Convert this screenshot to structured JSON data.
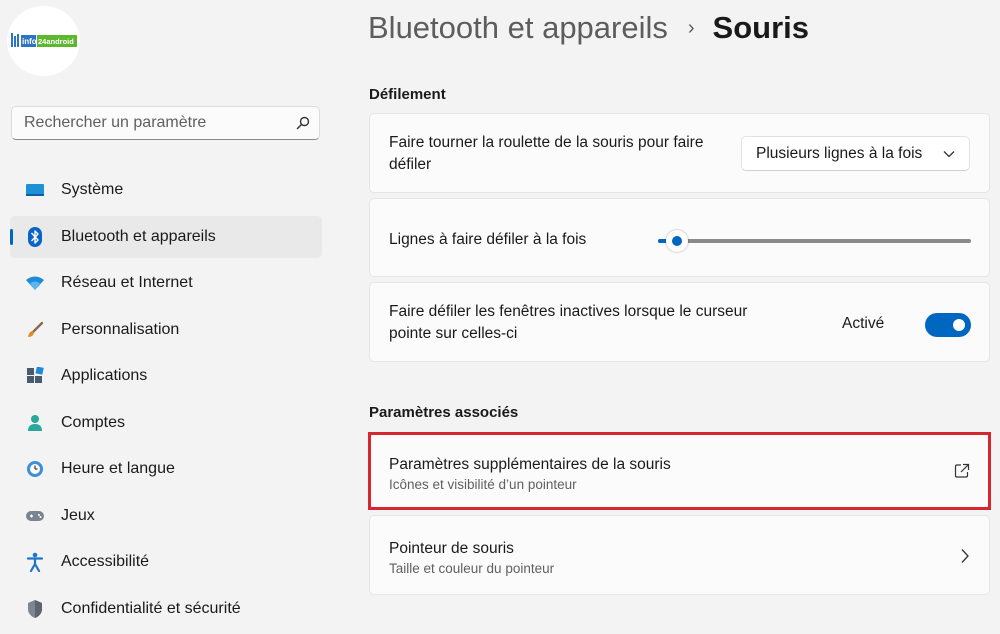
{
  "sidebar": {
    "logo_text_1": "info",
    "logo_text_2": "24android",
    "search": {
      "placeholder": "Rechercher un paramètre"
    },
    "items": [
      {
        "label": "Système",
        "icon": "monitor-icon",
        "active": false
      },
      {
        "label": "Bluetooth et appareils",
        "icon": "bluetooth-icon",
        "active": true
      },
      {
        "label": "Réseau et Internet",
        "icon": "wifi-icon",
        "active": false
      },
      {
        "label": "Personnalisation",
        "icon": "brush-icon",
        "active": false
      },
      {
        "label": "Applications",
        "icon": "apps-icon",
        "active": false
      },
      {
        "label": "Comptes",
        "icon": "person-icon",
        "active": false
      },
      {
        "label": "Heure et langue",
        "icon": "clock-globe-icon",
        "active": false
      },
      {
        "label": "Jeux",
        "icon": "gamepad-icon",
        "active": false
      },
      {
        "label": "Accessibilité",
        "icon": "accessibility-icon",
        "active": false
      },
      {
        "label": "Confidentialité et sécurité",
        "icon": "shield-icon",
        "active": false
      }
    ]
  },
  "header": {
    "parent": "Bluetooth et appareils",
    "separator": "›",
    "current": "Souris"
  },
  "scrolling": {
    "title": "Défilement",
    "wheel": {
      "label": "Faire tourner la roulette de la souris pour faire défiler",
      "selected": "Plusieurs lignes à la fois"
    },
    "lines": {
      "label": "Lignes à faire défiler à la fois",
      "value_fraction": 0.06
    },
    "inactive": {
      "label": "Faire défiler les fenêtres inactives lorsque le curseur pointe sur celles-ci",
      "state": "Activé",
      "on": true
    }
  },
  "related": {
    "title": "Paramètres associés",
    "additional": {
      "title": "Paramètres supplémentaires de la souris",
      "subtitle": "Icônes et visibilité d’un pointeur",
      "icon": "external-link-icon"
    },
    "pointer": {
      "title": "Pointeur de souris",
      "subtitle": "Taille et couleur du pointeur",
      "icon": "chevron-right-icon"
    }
  },
  "colors": {
    "accent": "#0067c0",
    "highlight": "#d6272f",
    "background": "#f3f3f3",
    "card": "#fbfbfb"
  }
}
